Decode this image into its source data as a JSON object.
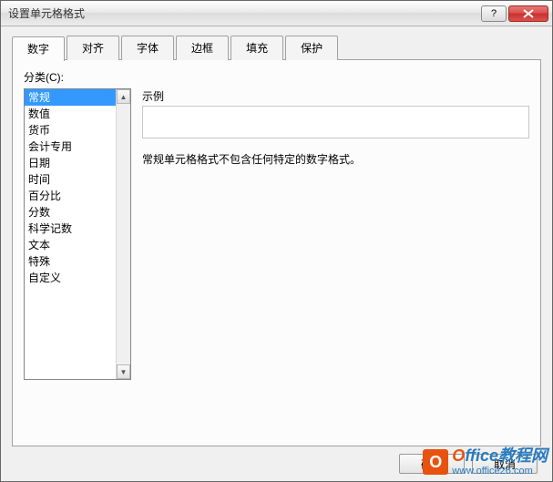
{
  "titlebar": {
    "title": "设置单元格格式"
  },
  "tabs": [
    {
      "label": "数字",
      "active": true
    },
    {
      "label": "对齐",
      "active": false
    },
    {
      "label": "字体",
      "active": false
    },
    {
      "label": "边框",
      "active": false
    },
    {
      "label": "填充",
      "active": false
    },
    {
      "label": "保护",
      "active": false
    }
  ],
  "panel": {
    "categoryLabel": "分类(C):",
    "sampleLabel": "示例",
    "description": "常规单元格格式不包含任何特定的数字格式。"
  },
  "categories": [
    {
      "label": "常规",
      "selected": true
    },
    {
      "label": "数值",
      "selected": false
    },
    {
      "label": "货币",
      "selected": false
    },
    {
      "label": "会计专用",
      "selected": false
    },
    {
      "label": "日期",
      "selected": false
    },
    {
      "label": "时间",
      "selected": false
    },
    {
      "label": "百分比",
      "selected": false
    },
    {
      "label": "分数",
      "selected": false
    },
    {
      "label": "科学记数",
      "selected": false
    },
    {
      "label": "文本",
      "selected": false
    },
    {
      "label": "特殊",
      "selected": false
    },
    {
      "label": "自定义",
      "selected": false
    }
  ],
  "buttons": {
    "ok": "确定",
    "cancel": "取消"
  },
  "watermark": {
    "logoLetter": "O",
    "brand1a": "O",
    "brand1b": "ffice",
    "brand1c": "教程网",
    "url": "www.office26.com"
  }
}
